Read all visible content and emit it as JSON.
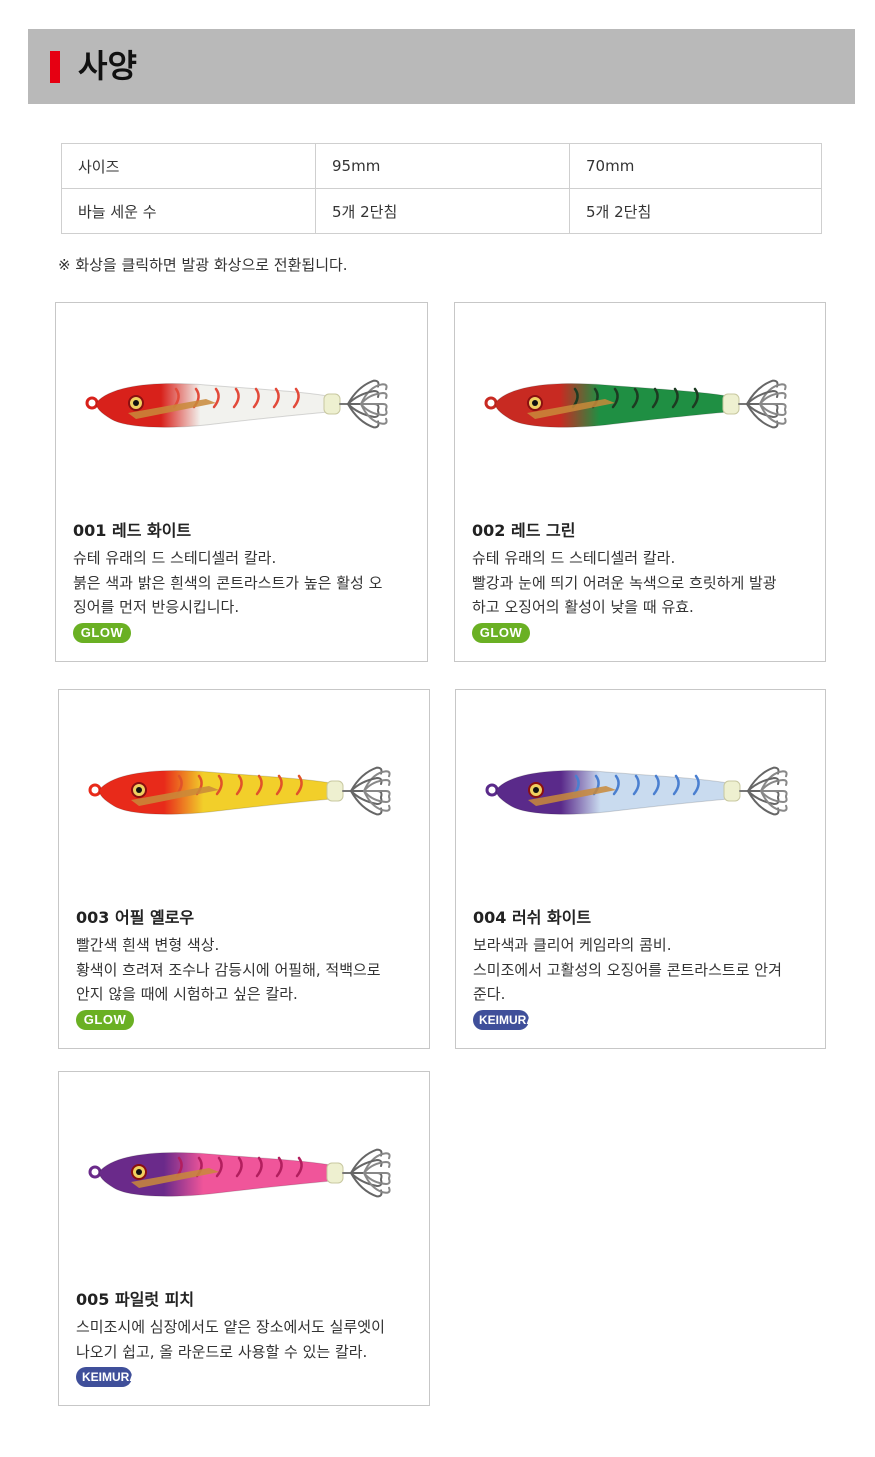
{
  "header": {
    "title": "사양"
  },
  "spec_table": {
    "rows": [
      [
        "사이즈",
        "95mm",
        "70mm"
      ],
      [
        "바늘 세운 수",
        "5개 2단침",
        "5개 2단침"
      ]
    ]
  },
  "note": "※ 화상을 클릭하면 발광 화상으로 전환됩니다.",
  "products": [
    {
      "name": "001 레드 화이트",
      "desc": "슈테 유래의 드 스테디셀러 칼라.\n붉은 색과 밝은 흰색의 콘트라스트가 높은 활성 오\n징어를 먼저 반응시킵니다.",
      "badge": "GLOW",
      "head_color": "#d8211b",
      "body_color": "#f2f2ee",
      "mark_color": "#e24a3a"
    },
    {
      "name": "002 레드 그린",
      "desc": "슈테 유래의 드 스테디셀러 칼라.\n빨강과 눈에 띄기 어려운 녹색으로 흐릿하게 발광\n하고 오징어의 활성이 낮을 때 유효.",
      "badge": "GLOW",
      "head_color": "#c82a22",
      "body_color": "#1f8f43",
      "mark_color": "#1d3b22"
    },
    {
      "name": "003 어필 옐로우",
      "desc": "빨간색 흰색 변형 색상.\n황색이 흐려져 조수나 감등시에 어필해, 적백으로\n안지 않을 때에 시험하고 싶은 칼라.",
      "badge": "GLOW",
      "head_color": "#e82a1a",
      "body_color": "#f2cf2a",
      "mark_color": "#e0522a"
    },
    {
      "name": "004 러쉬 화이트",
      "desc": "보라색과 클리어 케임라의 콤비.\n스미조에서 고활성의 오징어를 콘트라스트로 안겨\n준다.",
      "badge": "KEIMURA",
      "head_color": "#5a2a8a",
      "body_color": "#c9dbef",
      "mark_color": "#4a7fd0"
    },
    {
      "name": "005 파일럿 피치",
      "desc": "스미조시에 심장에서도 얕은 장소에서도 실루엣이\n나오기 쉽고, 올 라운드로 사용할 수 있는 칼라.",
      "badge": "KEIMURA",
      "head_color": "#6a2a8a",
      "body_color": "#f0559a",
      "mark_color": "#b21e5e"
    }
  ]
}
